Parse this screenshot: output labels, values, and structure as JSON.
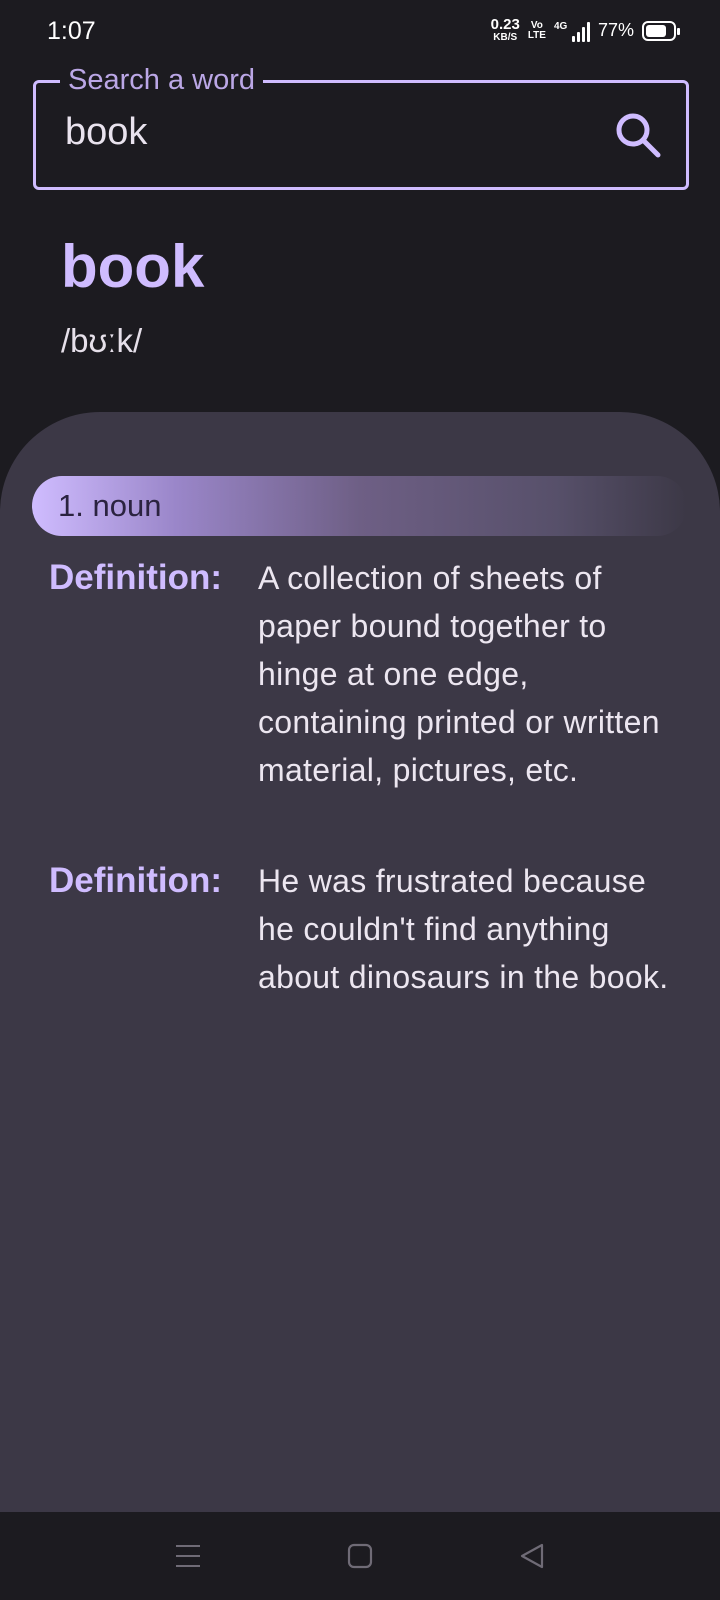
{
  "status_bar": {
    "time": "1:07",
    "net_speed_value": "0.23",
    "net_speed_unit": "KB/S",
    "volte_top": "Vo",
    "volte_bottom": "LTE",
    "network_type": "4G",
    "battery_percent": "77%",
    "battery_level": 0.77
  },
  "search": {
    "label": "Search a word",
    "value": "book",
    "icon": "search-icon"
  },
  "word": {
    "title": "book",
    "phonetic": "/bʊːk/"
  },
  "meanings": [
    {
      "part_of_speech": "1. noun",
      "entries": [
        {
          "label": "Definition:",
          "text": "A collection of sheets of paper bound together to hinge at one edge, containing printed or written material, pictures, etc."
        },
        {
          "label": "Definition:",
          "text": "He was frustrated because he couldn't find anything about dinosaurs in the book."
        }
      ]
    }
  ],
  "nav_bar": {
    "icons": [
      "menu-icon",
      "home-icon",
      "back-icon"
    ]
  },
  "colors": {
    "background": "#1c1b20",
    "accent": "#cfbcff",
    "sheet": "#3c3846"
  }
}
